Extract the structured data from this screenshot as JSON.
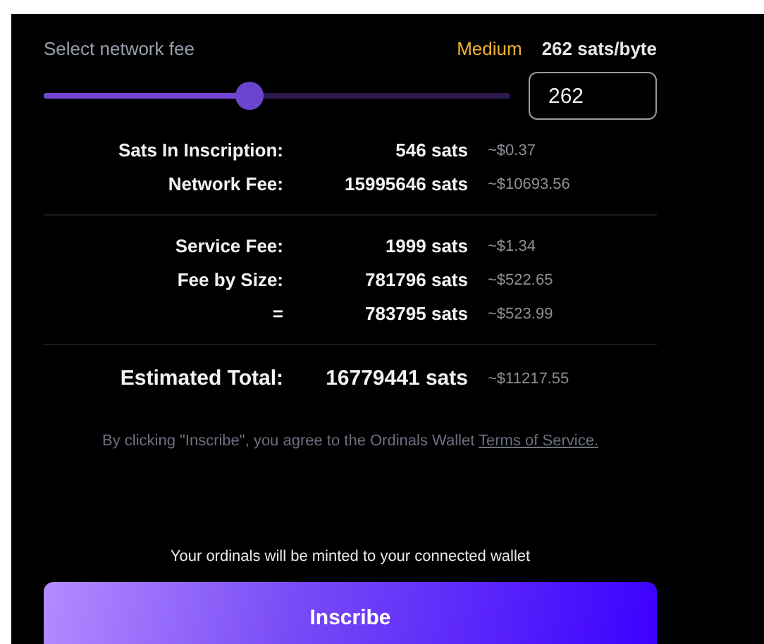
{
  "fee": {
    "label": "Select network fee",
    "tier": "Medium",
    "rate": "262 sats/byte",
    "level": 0.44,
    "value": "262"
  },
  "sections": [
    {
      "kind": "normal",
      "rows": [
        {
          "label": "Sats In Inscription:",
          "sats": "546 sats",
          "usd": "~$0.37"
        },
        {
          "label": "Network Fee:",
          "sats": "15995646 sats",
          "usd": "~$10693.56"
        }
      ]
    },
    {
      "kind": "normal",
      "rows": [
        {
          "label": "Service Fee:",
          "sats": "1999 sats",
          "usd": "~$1.34"
        },
        {
          "label": "Fee by Size:",
          "sats": "781796 sats",
          "usd": "~$522.65"
        },
        {
          "label": "=",
          "sats": "783795 sats",
          "usd": "~$523.99"
        }
      ]
    },
    {
      "kind": "total",
      "rows": [
        {
          "label": "Estimated Total:",
          "sats": "16779441 sats",
          "usd": "~$11217.55"
        }
      ]
    }
  ],
  "terms": {
    "text": "By clicking \"Inscribe\", you agree to the Ordinals Wallet",
    "link": "Terms of Service."
  },
  "note": "Your ordinals will be minted to your connected wallet",
  "button": "Inscribe"
}
